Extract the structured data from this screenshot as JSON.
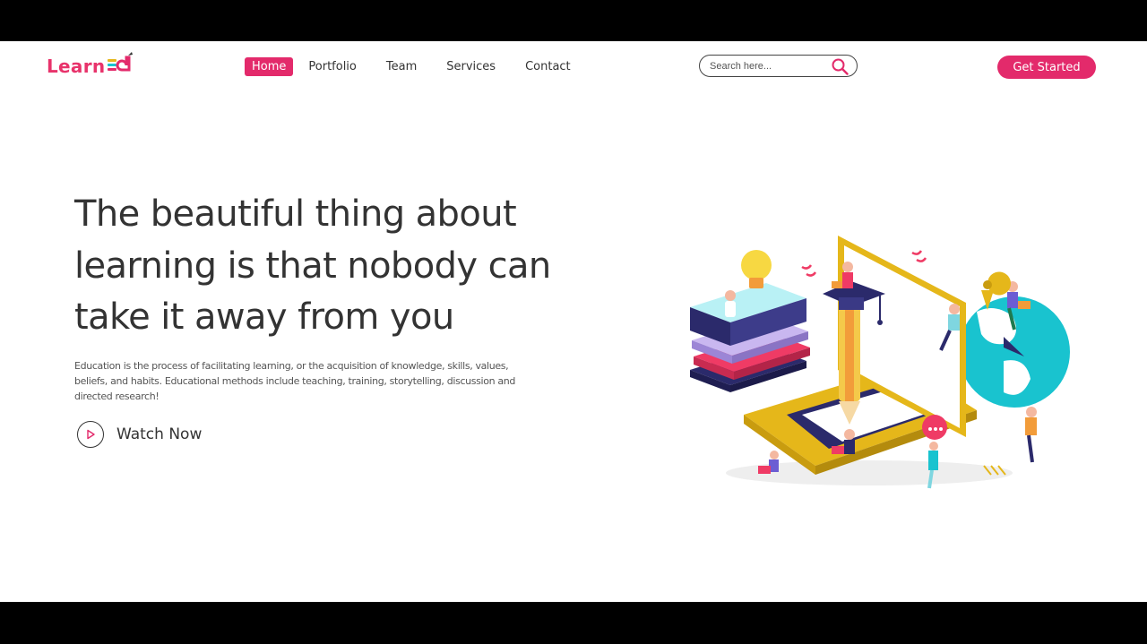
{
  "brand": {
    "name": "Learn",
    "mark_text": "ed"
  },
  "nav": {
    "items": [
      {
        "label": "Home",
        "active": true
      },
      {
        "label": "Portfolio",
        "active": false
      },
      {
        "label": "Team",
        "active": false
      },
      {
        "label": "Services",
        "active": false
      },
      {
        "label": "Contact",
        "active": false
      }
    ]
  },
  "search": {
    "placeholder": "Search here...",
    "value": "",
    "icon": "search-icon"
  },
  "cta": {
    "label": "Get Started"
  },
  "hero": {
    "headline": "The beautiful thing about learning is that nobody can take it away from you",
    "description": "Education is the process of facilitating learning, or the acquisition of knowledge, skills, values, beliefs, and habits. Educational methods include teaching, training, storytelling, discussion and directed research!",
    "watch_label": "Watch Now",
    "watch_icon": "play-icon"
  },
  "colors": {
    "accent": "#e32a6b",
    "text": "#333333",
    "teal": "#19c3cf",
    "gold": "#e5b71a",
    "navy": "#2b2a6b"
  }
}
